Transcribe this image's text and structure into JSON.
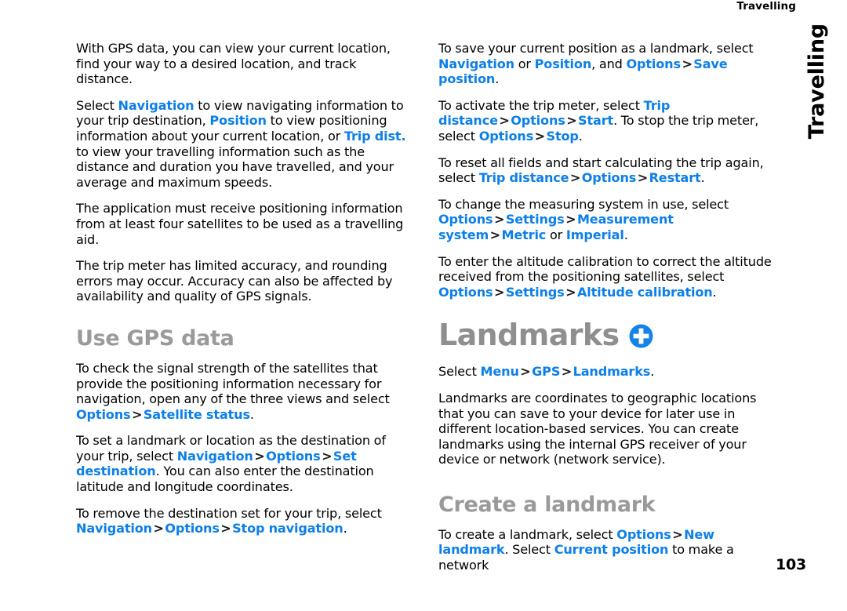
{
  "header": {
    "running_head": "Travelling"
  },
  "thumb_tab": {
    "label": "Travelling"
  },
  "page_number": "103",
  "colors": {
    "link_blue": "#0d7fe8",
    "heading_gray": "#9a9a9a",
    "body_black": "#000000",
    "badge_blue": "#1482e6"
  },
  "left_column": {
    "paragraphs": [
      {
        "id": "p-gps-intro",
        "runs": [
          {
            "t": "With GPS data, you can view your current location, find your way to a desired location, and track distance.",
            "s": "plain"
          }
        ]
      },
      {
        "id": "p-select-navigation",
        "runs": [
          {
            "t": "Select ",
            "s": "plain"
          },
          {
            "t": "Navigation",
            "s": "ui"
          },
          {
            "t": " to view navigating information to your trip destination, ",
            "s": "plain"
          },
          {
            "t": "Position",
            "s": "ui"
          },
          {
            "t": " to view positioning information about your current location, or ",
            "s": "plain"
          },
          {
            "t": "Trip dist.",
            "s": "ui"
          },
          {
            "t": " to view your travelling information such as the distance and duration you have travelled, and your average and maximum speeds.",
            "s": "plain"
          }
        ]
      },
      {
        "id": "p-four-satellites",
        "runs": [
          {
            "t": "The application must receive positioning information from at least four satellites to be used as a travelling aid.",
            "s": "plain"
          }
        ]
      },
      {
        "id": "p-trip-meter-accuracy",
        "runs": [
          {
            "t": "The trip meter has limited accuracy, and rounding errors may occur. Accuracy can also be affected by availability and quality of GPS signals.",
            "s": "plain"
          }
        ]
      }
    ],
    "heading_use_gps_data": "Use GPS data",
    "paragraphs_after_heading": [
      {
        "id": "p-signal-strength",
        "runs": [
          {
            "t": "To check the signal strength of the satellites that provide the positioning information necessary for navigation, open any of the three views and select ",
            "s": "plain"
          },
          {
            "t": "Options",
            "s": "ui"
          },
          {
            "t": ">",
            "s": "sep"
          },
          {
            "t": "Satellite status",
            "s": "ui"
          },
          {
            "t": ".",
            "s": "plain"
          }
        ]
      },
      {
        "id": "p-set-destination",
        "runs": [
          {
            "t": "To set a landmark or location as the destination of your trip, select ",
            "s": "plain"
          },
          {
            "t": "Navigation",
            "s": "ui"
          },
          {
            "t": ">",
            "s": "sep"
          },
          {
            "t": "Options",
            "s": "ui"
          },
          {
            "t": ">",
            "s": "sep"
          },
          {
            "t": "Set destination",
            "s": "ui"
          },
          {
            "t": ". You can also enter the destination latitude and longitude coordinates.",
            "s": "plain"
          }
        ]
      },
      {
        "id": "p-stop-navigation",
        "runs": [
          {
            "t": "To remove the destination set for your trip, select ",
            "s": "plain"
          },
          {
            "t": "Navigation",
            "s": "ui"
          },
          {
            "t": ">",
            "s": "sep"
          },
          {
            "t": "Options",
            "s": "ui"
          },
          {
            "t": ">",
            "s": "sep"
          },
          {
            "t": "Stop navigation",
            "s": "ui"
          },
          {
            "t": ".",
            "s": "plain"
          }
        ]
      }
    ]
  },
  "right_column": {
    "paragraphs_top": [
      {
        "id": "p-save-position",
        "runs": [
          {
            "t": "To save your current position as a landmark, select ",
            "s": "plain"
          },
          {
            "t": "Navigation",
            "s": "ui"
          },
          {
            "t": " or ",
            "s": "plain"
          },
          {
            "t": "Position",
            "s": "ui"
          },
          {
            "t": ", and ",
            "s": "plain"
          },
          {
            "t": "Options",
            "s": "ui"
          },
          {
            "t": ">",
            "s": "sep"
          },
          {
            "t": "Save position",
            "s": "ui"
          },
          {
            "t": ".",
            "s": "plain"
          }
        ]
      },
      {
        "id": "p-trip-meter-start-stop",
        "runs": [
          {
            "t": "To activate the trip meter, select ",
            "s": "plain"
          },
          {
            "t": "Trip distance",
            "s": "ui"
          },
          {
            "t": ">",
            "s": "sep"
          },
          {
            "t": "Options",
            "s": "ui"
          },
          {
            "t": ">",
            "s": "sep"
          },
          {
            "t": "Start",
            "s": "ui"
          },
          {
            "t": ". To stop the trip meter, select ",
            "s": "plain"
          },
          {
            "t": "Options",
            "s": "ui"
          },
          {
            "t": ">",
            "s": "sep"
          },
          {
            "t": "Stop",
            "s": "ui"
          },
          {
            "t": ".",
            "s": "plain"
          }
        ]
      },
      {
        "id": "p-restart",
        "runs": [
          {
            "t": "To reset all fields and start calculating the trip again, select ",
            "s": "plain"
          },
          {
            "t": "Trip distance",
            "s": "ui"
          },
          {
            "t": ">",
            "s": "sep"
          },
          {
            "t": "Options",
            "s": "ui"
          },
          {
            "t": ">",
            "s": "sep"
          },
          {
            "t": "Restart",
            "s": "ui"
          },
          {
            "t": ".",
            "s": "plain"
          }
        ]
      },
      {
        "id": "p-measurement-system",
        "runs": [
          {
            "t": "To change the measuring system in use, select ",
            "s": "plain"
          },
          {
            "t": "Options",
            "s": "ui"
          },
          {
            "t": ">",
            "s": "sep"
          },
          {
            "t": "Settings",
            "s": "ui"
          },
          {
            "t": ">",
            "s": "sep"
          },
          {
            "t": "Measurement system",
            "s": "ui"
          },
          {
            "t": ">",
            "s": "sep"
          },
          {
            "t": "Metric",
            "s": "ui"
          },
          {
            "t": " or ",
            "s": "plain"
          },
          {
            "t": "Imperial",
            "s": "ui"
          },
          {
            "t": ".",
            "s": "plain"
          }
        ]
      },
      {
        "id": "p-altitude-calibration",
        "runs": [
          {
            "t": "To enter the altitude calibration to correct the altitude received from the positioning satellites, select ",
            "s": "plain"
          },
          {
            "t": "Options",
            "s": "ui"
          },
          {
            "t": ">",
            "s": "sep"
          },
          {
            "t": "Settings",
            "s": "ui"
          },
          {
            "t": ">",
            "s": "sep"
          },
          {
            "t": "Altitude calibration",
            "s": "ui"
          },
          {
            "t": ".",
            "s": "plain"
          }
        ]
      }
    ],
    "heading_landmarks": "Landmarks",
    "landmarks_icon": "plus-circle-icon",
    "paragraphs_landmarks": [
      {
        "id": "p-select-menu-gps",
        "runs": [
          {
            "t": "Select ",
            "s": "plain"
          },
          {
            "t": "Menu",
            "s": "ui"
          },
          {
            "t": ">",
            "s": "sep"
          },
          {
            "t": "GPS",
            "s": "ui"
          },
          {
            "t": ">",
            "s": "sep"
          },
          {
            "t": "Landmarks",
            "s": "ui"
          },
          {
            "t": ".",
            "s": "plain"
          }
        ]
      },
      {
        "id": "p-landmarks-desc",
        "runs": [
          {
            "t": "Landmarks are coordinates to geographic locations that you can save to your device for later use in different location-based services. You can create landmarks using the internal GPS receiver of your device or network (network service).",
            "s": "plain"
          }
        ]
      }
    ],
    "heading_create_landmark": "Create a landmark",
    "paragraphs_create": [
      {
        "id": "p-create-landmark",
        "runs": [
          {
            "t": "To create a landmark, select ",
            "s": "plain"
          },
          {
            "t": "Options",
            "s": "ui"
          },
          {
            "t": ">",
            "s": "sep"
          },
          {
            "t": "New landmark",
            "s": "ui"
          },
          {
            "t": ". Select ",
            "s": "plain"
          },
          {
            "t": "Current position",
            "s": "ui"
          },
          {
            "t": " to make a network",
            "s": "plain"
          }
        ]
      }
    ]
  }
}
